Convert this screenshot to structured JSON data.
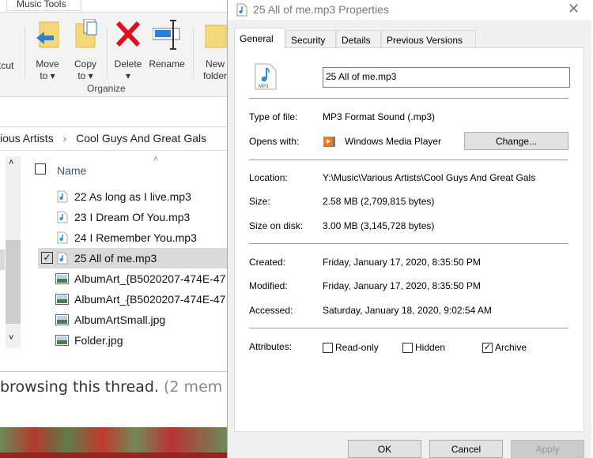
{
  "explorer": {
    "ribbon_tab": "Music Tools",
    "cut_fragment": "tcut",
    "buttons": {
      "move": "Move",
      "move2": "to",
      "copy": "Copy",
      "copy2": "to",
      "delete": "Delete",
      "rename": "Rename",
      "newfolder": "New",
      "newfolder2": "folder"
    },
    "group_label": "Organize",
    "breadcrumb": [
      "ious Artists",
      "Cool Guys And Great Gals"
    ],
    "column_name": "Name",
    "files": [
      {
        "name": "22 As long as I live.mp3",
        "type": "mp3"
      },
      {
        "name": "23 I Dream Of You.mp3",
        "type": "mp3"
      },
      {
        "name": "24 I Remember You.mp3",
        "type": "mp3"
      },
      {
        "name": "25 All of me.mp3",
        "type": "mp3",
        "selected": true
      },
      {
        "name": "AlbumArt_{B5020207-474E-47",
        "type": "img"
      },
      {
        "name": "AlbumArt_{B5020207-474E-47",
        "type": "img"
      },
      {
        "name": "AlbumArtSmall.jpg",
        "type": "img"
      },
      {
        "name": "Folder.jpg",
        "type": "img"
      }
    ]
  },
  "web": {
    "text": "browsing this thread.",
    "text_muted": "(2 mem"
  },
  "dialog": {
    "title": "25 All of me.mp3 Properties",
    "tabs": [
      "General",
      "Security",
      "Details",
      "Previous Versions"
    ],
    "file_icon_label": "MP3",
    "file_name": "25 All of me.mp3",
    "type_label": "Type of file:",
    "type_value": "MP3 Format Sound (.mp3)",
    "opens_label": "Opens with:",
    "opens_value": "Windows Media Player",
    "change_button": "Change...",
    "location_label": "Location:",
    "location_value": "Y:\\Music\\Various Artists\\Cool Guys And Great Gals",
    "size_label": "Size:",
    "size_value": "2.58 MB (2,709,815 bytes)",
    "sizedisk_label": "Size on disk:",
    "sizedisk_value": "3.00 MB (3,145,728 bytes)",
    "created_label": "Created:",
    "created_value": "Friday, January 17, 2020, 8:35:50 PM",
    "modified_label": "Modified:",
    "modified_value": "Friday, January 17, 2020, 8:35:50 PM",
    "accessed_label": "Accessed:",
    "accessed_value": "Saturday, January 18, 2020, 9:02:54 AM",
    "attributes_label": "Attributes:",
    "attributes": [
      {
        "label": "Read-only",
        "checked": false
      },
      {
        "label": "Hidden",
        "checked": false
      },
      {
        "label": "Archive",
        "checked": true
      }
    ],
    "ok": "OK",
    "cancel": "Cancel",
    "apply": "Apply"
  }
}
